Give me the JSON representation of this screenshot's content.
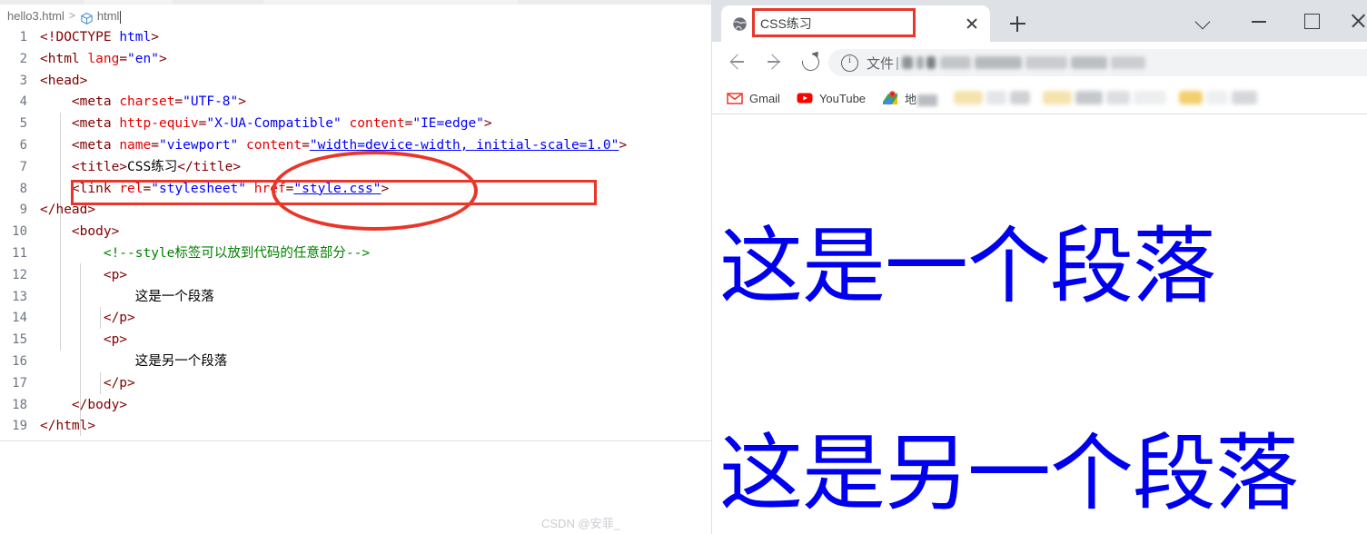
{
  "editor": {
    "breadcrumb": {
      "file": "hello3.html",
      "separator": ">",
      "symbol_icon": "html-symbol-icon",
      "symbol": "html"
    },
    "line_numbers": [
      "1",
      "2",
      "3",
      "4",
      "5",
      "6",
      "7",
      "8",
      "9",
      "10",
      "11",
      "12",
      "13",
      "14",
      "15",
      "16",
      "17",
      "18",
      "19"
    ],
    "lines": [
      {
        "n": "1",
        "tokens": [
          {
            "t": "tag",
            "s": "<!DOCTYPE "
          },
          {
            "t": "val",
            "s": "html"
          },
          {
            "t": "tag",
            "s": ">"
          }
        ]
      },
      {
        "n": "2",
        "tokens": [
          {
            "t": "tag",
            "s": "<html "
          },
          {
            "t": "attr",
            "s": "lang"
          },
          {
            "t": "tag",
            "s": "="
          },
          {
            "t": "val",
            "s": "\"en\""
          },
          {
            "t": "tag",
            "s": ">"
          }
        ]
      },
      {
        "n": "3",
        "tokens": [
          {
            "t": "tag",
            "s": "<head>"
          }
        ]
      },
      {
        "n": "4",
        "tokens": [
          {
            "t": "text",
            "s": "    "
          },
          {
            "t": "tag",
            "s": "<meta "
          },
          {
            "t": "attr",
            "s": "charset"
          },
          {
            "t": "tag",
            "s": "="
          },
          {
            "t": "val",
            "s": "\"UTF-8\""
          },
          {
            "t": "tag",
            "s": ">"
          }
        ]
      },
      {
        "n": "5",
        "tokens": [
          {
            "t": "text",
            "s": "    "
          },
          {
            "t": "tag",
            "s": "<meta "
          },
          {
            "t": "attr",
            "s": "http-equiv"
          },
          {
            "t": "tag",
            "s": "="
          },
          {
            "t": "val",
            "s": "\"X-UA-Compatible\""
          },
          {
            "t": "text",
            "s": " "
          },
          {
            "t": "attr",
            "s": "content"
          },
          {
            "t": "tag",
            "s": "="
          },
          {
            "t": "val",
            "s": "\"IE=edge\""
          },
          {
            "t": "tag",
            "s": ">"
          }
        ]
      },
      {
        "n": "6",
        "tokens": [
          {
            "t": "text",
            "s": "    "
          },
          {
            "t": "tag",
            "s": "<meta "
          },
          {
            "t": "attr",
            "s": "name"
          },
          {
            "t": "tag",
            "s": "="
          },
          {
            "t": "val",
            "s": "\"viewport\""
          },
          {
            "t": "text",
            "s": " "
          },
          {
            "t": "attr",
            "s": "content"
          },
          {
            "t": "tag",
            "s": "="
          },
          {
            "t": "link",
            "s": "\"width=device-width, initial-scale=1.0\""
          },
          {
            "t": "tag",
            "s": ">"
          }
        ]
      },
      {
        "n": "7",
        "tokens": [
          {
            "t": "text",
            "s": "    "
          },
          {
            "t": "tag",
            "s": "<title>"
          },
          {
            "t": "text",
            "s": "CSS练习"
          },
          {
            "t": "tag",
            "s": "</title>"
          }
        ]
      },
      {
        "n": "8",
        "tokens": [
          {
            "t": "text",
            "s": "    "
          },
          {
            "t": "tag",
            "s": "<link "
          },
          {
            "t": "attr",
            "s": "rel"
          },
          {
            "t": "tag",
            "s": "="
          },
          {
            "t": "val",
            "s": "\"stylesheet\""
          },
          {
            "t": "text",
            "s": " "
          },
          {
            "t": "attr",
            "s": "href"
          },
          {
            "t": "tag",
            "s": "="
          },
          {
            "t": "link",
            "s": "\"style.css\""
          },
          {
            "t": "tag",
            "s": ">"
          }
        ]
      },
      {
        "n": "9",
        "tokens": [
          {
            "t": "tag",
            "s": "</head>"
          }
        ]
      },
      {
        "n": "10",
        "tokens": [
          {
            "t": "text",
            "s": "    "
          },
          {
            "t": "tag",
            "s": "<body>"
          }
        ]
      },
      {
        "n": "11",
        "tokens": [
          {
            "t": "text",
            "s": "        "
          },
          {
            "t": "cmt",
            "s": "<!--style标签可以放到代码的任意部分-->"
          }
        ]
      },
      {
        "n": "12",
        "tokens": [
          {
            "t": "text",
            "s": "        "
          },
          {
            "t": "tag",
            "s": "<p>"
          }
        ]
      },
      {
        "n": "13",
        "tokens": [
          {
            "t": "text",
            "s": "            这是一个段落"
          }
        ]
      },
      {
        "n": "14",
        "tokens": [
          {
            "t": "text",
            "s": "        "
          },
          {
            "t": "tag",
            "s": "</p>"
          }
        ]
      },
      {
        "n": "15",
        "tokens": [
          {
            "t": "text",
            "s": "        "
          },
          {
            "t": "tag",
            "s": "<p>"
          }
        ]
      },
      {
        "n": "16",
        "tokens": [
          {
            "t": "text",
            "s": "            这是另一个段落"
          }
        ]
      },
      {
        "n": "17",
        "tokens": [
          {
            "t": "text",
            "s": "        "
          },
          {
            "t": "tag",
            "s": "</p>"
          }
        ]
      },
      {
        "n": "18",
        "tokens": [
          {
            "t": "text",
            "s": "    "
          },
          {
            "t": "tag",
            "s": "</body>"
          }
        ]
      },
      {
        "n": "19",
        "tokens": [
          {
            "t": "tag",
            "s": "</html>"
          }
        ]
      }
    ],
    "annotations": {
      "color": "#e8362a",
      "rect_target_line": "8",
      "ellipse_target": "href=\"style.css\""
    }
  },
  "browser": {
    "tab": {
      "favicon": "globe-favicon",
      "title": "CSS练习",
      "close_icon": "close-icon",
      "highlight_color": "#e8362a"
    },
    "new_tab_icon": "plus-icon",
    "window_controls": [
      {
        "name": "tab-search",
        "icon": "chevron-down-icon"
      },
      {
        "name": "minimize",
        "icon": "minimize-icon"
      },
      {
        "name": "maximize",
        "icon": "maximize-icon"
      },
      {
        "name": "close",
        "icon": "close-icon"
      }
    ],
    "toolbar": {
      "back_icon": "back-arrow-icon",
      "forward_icon": "forward-arrow-icon",
      "reload_icon": "reload-icon",
      "omnibox": {
        "info_icon": "info-circle-icon",
        "scheme_label": "文件",
        "separator": "|",
        "url_redacted": true
      },
      "share_icon": "share-icon",
      "bookmark_icon": "star-icon",
      "side_panel_icon": "side-panel-icon",
      "profile_icon": "avatar-icon",
      "menu_icon": "three-dots-menu-icon"
    },
    "bookmarks": [
      {
        "label": "Gmail",
        "icon": "gmail-icon",
        "blurred": false
      },
      {
        "label": "YouTube",
        "icon": "youtube-icon",
        "blurred": false
      },
      {
        "label": "地",
        "icon": "google-maps-icon",
        "blurred": "partial"
      }
    ],
    "bookmarks_blurred_count": 3,
    "page": {
      "paragraphs": [
        "这是一个段落",
        "这是另一个段落"
      ],
      "text_color": "#0000ee"
    }
  },
  "watermark": "CSDN @安菲_"
}
